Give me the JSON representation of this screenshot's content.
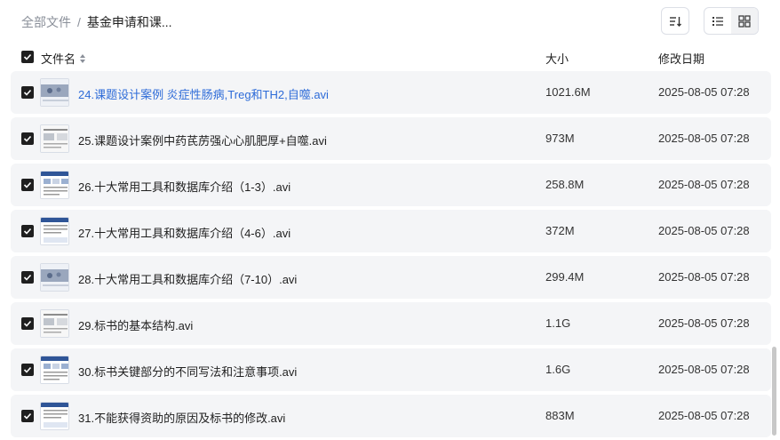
{
  "breadcrumb": {
    "root": "全部文件",
    "separator": "/",
    "current": "基金申请和课..."
  },
  "toolbar": {
    "sort_icon": "sort-icon",
    "list_view_icon": "list-view-icon",
    "grid_view_icon": "grid-view-icon"
  },
  "columns": {
    "name": "文件名",
    "size": "大小",
    "modified": "修改日期"
  },
  "files": [
    {
      "name": "24.课题设计案例 炎症性肠病,Treg和TH2,自噬.avi",
      "size": "1021.6M",
      "modified": "2025-08-05 07:28"
    },
    {
      "name": "25.课题设计案例中药芪苈强心心肌肥厚+自噬.avi",
      "size": "973M",
      "modified": "2025-08-05 07:28"
    },
    {
      "name": "26.十大常用工具和数据库介绍（1-3）.avi",
      "size": "258.8M",
      "modified": "2025-08-05 07:28"
    },
    {
      "name": "27.十大常用工具和数据库介绍（4-6）.avi",
      "size": "372M",
      "modified": "2025-08-05 07:28"
    },
    {
      "name": "28.十大常用工具和数据库介绍（7-10）.avi",
      "size": "299.4M",
      "modified": "2025-08-05 07:28"
    },
    {
      "name": "29.标书的基本结构.avi",
      "size": "1.1G",
      "modified": "2025-08-05 07:28"
    },
    {
      "name": "30.标书关键部分的不同写法和注意事项.avi",
      "size": "1.6G",
      "modified": "2025-08-05 07:28"
    },
    {
      "name": "31.不能获得资助的原因及标书的修改.avi",
      "size": "883M",
      "modified": "2025-08-05 07:28"
    }
  ],
  "colors": {
    "link": "#2d6bd8",
    "row_bg": "#f4f5f7",
    "checkbox": "#1f1f1f"
  }
}
